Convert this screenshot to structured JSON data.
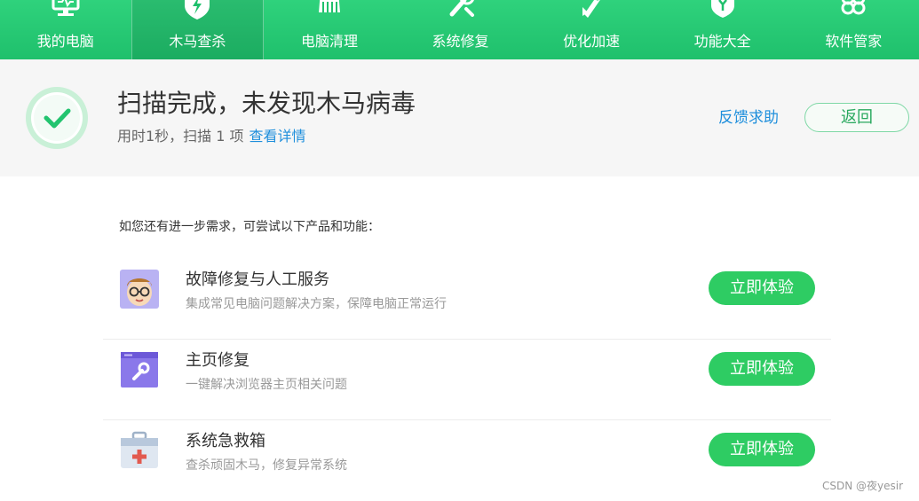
{
  "nav": {
    "items": [
      {
        "label": "我的电脑",
        "icon": "monitor-icon"
      },
      {
        "label": "木马查杀",
        "icon": "shield-lightning-icon",
        "active": true
      },
      {
        "label": "电脑清理",
        "icon": "broom-icon"
      },
      {
        "label": "系统修复",
        "icon": "wrench-icon"
      },
      {
        "label": "优化加速",
        "icon": "rocket-icon"
      },
      {
        "label": "功能大全",
        "icon": "shield-plus-icon"
      },
      {
        "label": "软件管家",
        "icon": "flower-icon"
      }
    ]
  },
  "result": {
    "title": "扫描完成，未发现木马病毒",
    "summary": "用时1秒，扫描 1 项",
    "details_link": "查看详情",
    "feedback_link": "反馈求助",
    "back_button": "返回"
  },
  "suggestions": {
    "hint": "如您还有进一步需求，可尝试以下产品和功能：",
    "items": [
      {
        "name": "故障修复与人工服务",
        "desc": "集成常见电脑问题解决方案，保障电脑正常运行",
        "button": "立即体验",
        "icon": "support-agent-icon"
      },
      {
        "name": "主页修复",
        "desc": "一键解决浏览器主页相关问题",
        "button": "立即体验",
        "icon": "browser-wrench-icon"
      },
      {
        "name": "系统急救箱",
        "desc": "查杀顽固木马，修复异常系统",
        "button": "立即体验",
        "icon": "first-aid-kit-icon"
      }
    ]
  },
  "colors": {
    "brand": "#22c46f",
    "button": "#2ecc63",
    "link": "#1f8fdc"
  },
  "watermark": "CSDN @夜yesir"
}
